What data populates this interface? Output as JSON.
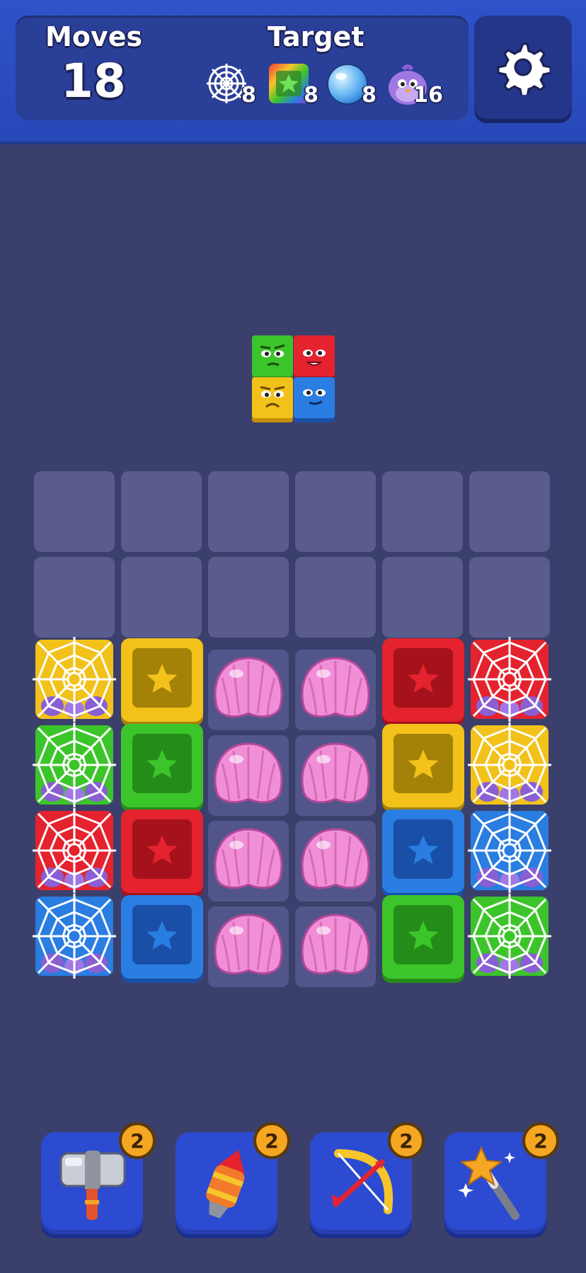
{
  "header": {
    "moves_label": "Moves",
    "moves_value": "18",
    "target_label": "Target",
    "targets": [
      {
        "icon": "web-icon",
        "count": "8"
      },
      {
        "icon": "rainbow-block-icon",
        "count": "8"
      },
      {
        "icon": "bubble-icon",
        "count": "8"
      },
      {
        "icon": "purple-bird-icon",
        "count": "16"
      }
    ],
    "settings_icon": "gear-icon"
  },
  "next_piece": {
    "colors": [
      "green",
      "red",
      "yellow",
      "blue"
    ]
  },
  "board": {
    "columns": 6,
    "rows": 6,
    "cells": [
      [
        "empty",
        "empty",
        "empty",
        "empty",
        "empty",
        "empty"
      ],
      [
        "empty",
        "empty",
        "empty",
        "empty",
        "empty",
        "empty"
      ],
      [
        "web-yellow",
        "star-yellow",
        "shell",
        "shell",
        "star-red",
        "web-red"
      ],
      [
        "web-green",
        "star-green",
        "shell",
        "shell",
        "star-yellow",
        "web-yellow"
      ],
      [
        "web-red",
        "star-red",
        "shell",
        "shell",
        "star-blue",
        "web-blue"
      ],
      [
        "web-blue",
        "star-blue",
        "shell",
        "shell",
        "star-green",
        "web-green"
      ]
    ]
  },
  "powerups": [
    {
      "name": "hammer",
      "icon": "hammer-icon",
      "count": "2"
    },
    {
      "name": "rocket",
      "icon": "rocket-icon",
      "count": "2"
    },
    {
      "name": "bow",
      "icon": "bow-icon",
      "count": "2"
    },
    {
      "name": "magic-wand",
      "icon": "magic-wand-icon",
      "count": "2"
    }
  ],
  "colors": {
    "yellow": "#f2c21b",
    "red": "#e4232f",
    "green": "#3cc52a",
    "blue": "#2a7de1",
    "shell": "#f08fd8",
    "board_bg": "#3b3f6b",
    "header_blue": "#2f52c9"
  }
}
